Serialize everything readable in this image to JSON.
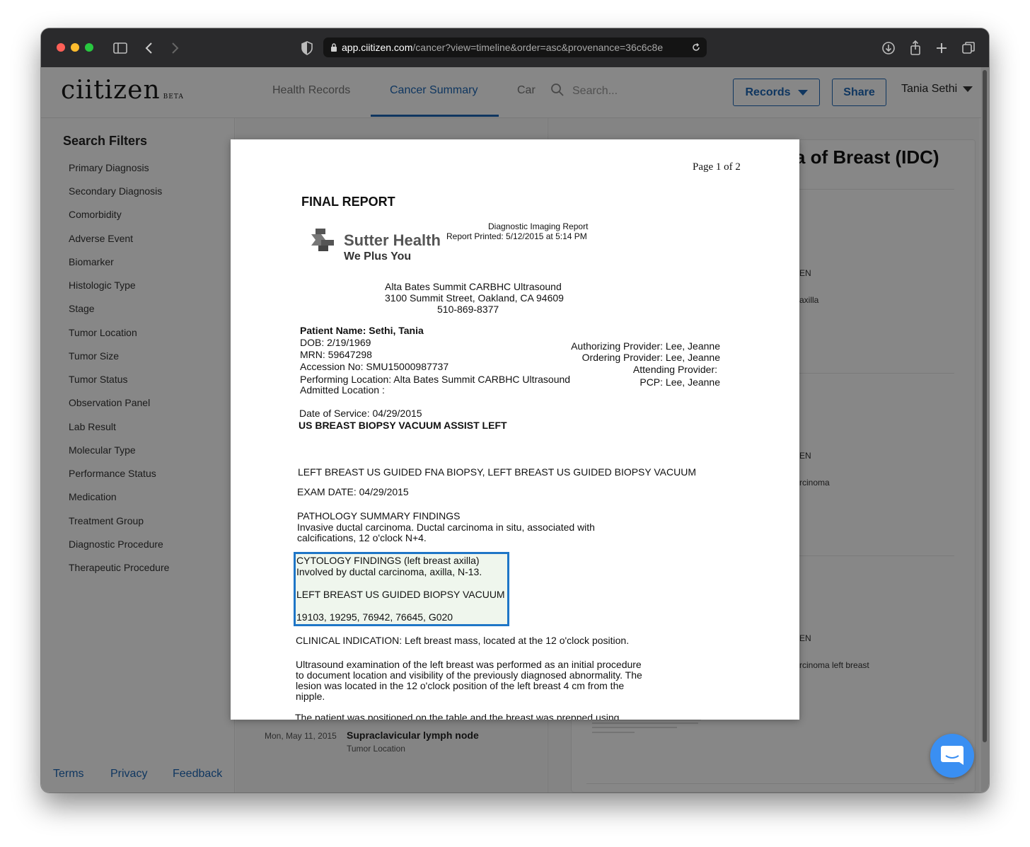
{
  "browser": {
    "url_host": "app.ciitizen.com",
    "url_path": "/cancer?view=timeline&order=asc&provenance=36c6c8e"
  },
  "app": {
    "logo": "ciitizen",
    "logo_badge": "BETA",
    "nav": {
      "health_records": "Health Records",
      "cancer_summary": "Cancer Summary",
      "truncated_tab": "Car"
    },
    "search_placeholder": "Search...",
    "records_button": "Records",
    "share_button": "Share",
    "user_name": "Tania Sethi"
  },
  "sidebar": {
    "title": "Search Filters",
    "filters": [
      "Primary Diagnosis",
      "Secondary Diagnosis",
      "Comorbidity",
      "Adverse Event",
      "Biomarker",
      "Histologic Type",
      "Stage",
      "Tumor Location",
      "Tumor Size",
      "Tumor Status",
      "Observation Panel",
      "Lab Result",
      "Molecular Type",
      "Performance Status",
      "Medication",
      "Treatment Group",
      "Diagnostic Procedure",
      "Therapeutic Procedure"
    ],
    "footer": {
      "terms": "Terms",
      "privacy": "Privacy",
      "feedback": "Feedback"
    }
  },
  "timeline": {
    "date": "Mon, May 11, 2015",
    "title": "Supraclavicular lymph node",
    "subtitle": "Tumor Location"
  },
  "detail": {
    "title_fragment": "na of Breast (IDC)",
    "frag_en_1": "EN",
    "frag_axilla": "axilla",
    "frag_en_2": "EN",
    "frag_rcinoma": "rcinoma",
    "frag_en_3": "EN",
    "frag_rcinoma_left": "rcinoma left breast"
  },
  "document": {
    "page": "Page 1 of 2",
    "heading": "FINAL REPORT",
    "report_type": "Diagnostic Imaging Report",
    "printed": "Report Printed: 5/12/2015 at 5:14 PM",
    "brand_name": "Sutter Health",
    "brand_tagline": "We Plus You",
    "facility_line1": "Alta Bates Summit CARBHC Ultrasound",
    "facility_line2": "3100 Summit Street, Oakland, CA 94609",
    "facility_line3": "510-869-8377",
    "patient_name": "Patient Name: Sethi, Tania",
    "dob": "DOB:  2/19/1969",
    "mrn": "MRN:  59647298",
    "accession": "Accession No:  SMU15000987737",
    "performing_location": "Performing Location: Alta Bates Summit CARBHC Ultrasound",
    "admitted_location": "Admitted Location :",
    "authorizing_provider": "Authorizing Provider: Lee, Jeanne",
    "ordering_provider": "Ordering Provider: Lee, Jeanne",
    "attending_provider": "Attending Provider:",
    "pcp": "PCP: Lee, Jeanne",
    "date_of_service": "Date of Service:  04/29/2015",
    "procedure": "US BREAST BIOPSY VACUUM ASSIST LEFT",
    "procedure_full": "LEFT BREAST US GUIDED FNA BIOPSY, LEFT BREAST US GUIDED BIOPSY VACUUM",
    "exam_date": "EXAM DATE: 04/29/2015",
    "path_heading": "PATHOLOGY SUMMARY FINDINGS",
    "path_line1": "Invasive ductal carcinoma. Ductal carcinoma in situ, associated with",
    "path_line2": "calcifications, 12 o'clock N+4.",
    "cyto_heading": "CYTOLOGY FINDINGS (left breast axilla)",
    "cyto_line": "Involved by ductal carcinoma, axilla, N-13.",
    "biopsy_heading": "LEFT BREAST US GUIDED BIOPSY VACUUM",
    "codes": "19103, 19295, 76942, 76645, G020",
    "clinical": "CLINICAL INDICATION: Left breast mass, located at the 12 o'clock position.",
    "us_line1": "Ultrasound examination of the left breast was performed as an initial procedure",
    "us_line2": "to document location and visibility of the previously diagnosed abnormality. The",
    "us_line3": "lesion was located in the 12 o'clock position of the left breast 4 cm from the",
    "us_line4": "nipple.",
    "cut_line": "The patient was positioned on the table and the breast was prepped using"
  }
}
